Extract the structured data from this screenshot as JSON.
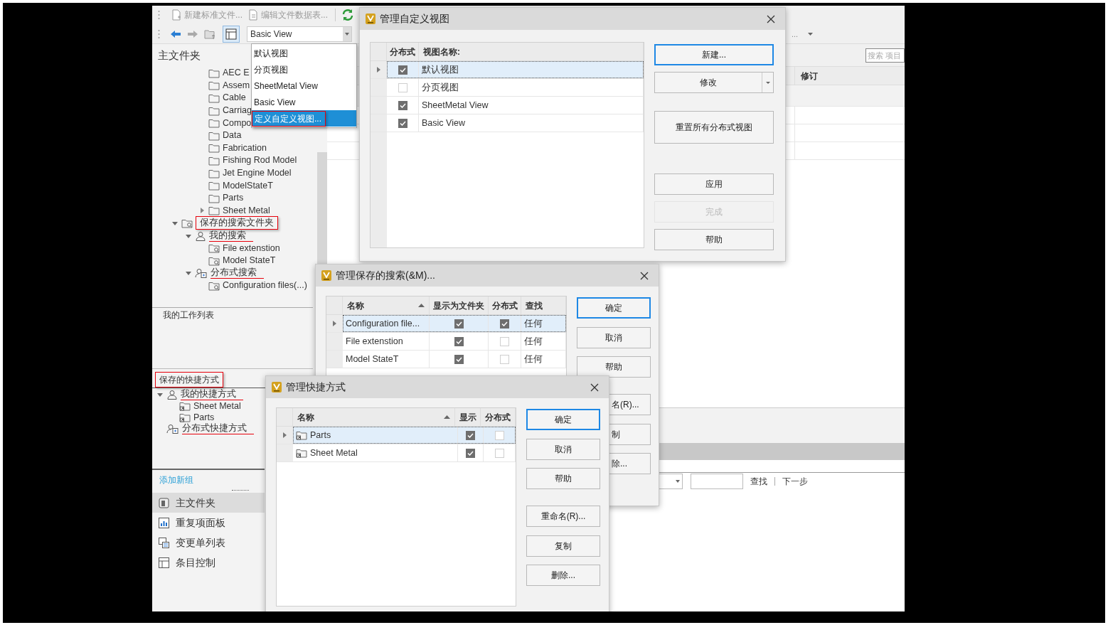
{
  "toolbar": {
    "actions": [
      {
        "label": "新建标准文件...",
        "kind": "new"
      },
      {
        "label": "编辑文件数据表...",
        "kind": "edit"
      }
    ],
    "view_select": {
      "value": "Basic View"
    },
    "overflow": "..."
  },
  "view_menu": [
    {
      "label": "默认视图",
      "selected": false
    },
    {
      "label": "分页视图",
      "selected": false
    },
    {
      "label": "SheetMetal View",
      "selected": false
    },
    {
      "label": "Basic View",
      "selected": false
    },
    {
      "label": "定义自定义视图...",
      "selected": true,
      "boxed": true
    }
  ],
  "left_panel": {
    "title": "主文件夹",
    "folders": [
      {
        "label": "AEC E"
      },
      {
        "label": "Assem"
      },
      {
        "label": "Cable"
      },
      {
        "label": "Carriag"
      },
      {
        "label": "Compo"
      },
      {
        "label": "Data"
      },
      {
        "label": "Fabrication"
      },
      {
        "label": "Fishing Rod Model"
      },
      {
        "label": "Jet Engine Model"
      },
      {
        "label": "ModelStateT"
      },
      {
        "label": "Parts"
      },
      {
        "label": "Sheet Metal",
        "expanded": false
      }
    ],
    "search_tree": [
      {
        "label": "保存的搜索文件夹",
        "kind": "search-folder",
        "expanded": true,
        "boxed": true,
        "children": [
          {
            "label": "我的搜索",
            "kind": "user",
            "expanded": true,
            "underlined": true,
            "children": [
              {
                "label": "File extenstion",
                "kind": "saved-search"
              },
              {
                "label": "Model StateT",
                "kind": "saved-search"
              }
            ]
          },
          {
            "label": "分布式搜索",
            "kind": "distributed",
            "expanded": true,
            "underlined": true,
            "children": [
              {
                "label": "Configuration files(...)",
                "kind": "saved-search"
              }
            ]
          }
        ]
      }
    ],
    "worklist_title": "我的工作列表",
    "shortcuts_title": {
      "label": "保存的快捷方式",
      "boxed": true
    },
    "shortcut_tree": [
      {
        "label": "我的快捷方式",
        "kind": "user",
        "expanded": true,
        "underlined": true,
        "children": [
          {
            "label": "Sheet Metal",
            "kind": "shortcut"
          },
          {
            "label": "Parts",
            "kind": "shortcut"
          }
        ]
      },
      {
        "label": "分布式快捷方式",
        "kind": "distributed",
        "underlined": true
      }
    ],
    "add_group": "添加新组",
    "nav": [
      {
        "label": "主文件夹",
        "kind": "folder",
        "selected": true
      },
      {
        "label": "重复项面板",
        "kind": "chart",
        "selected": false
      },
      {
        "label": "变更单列表",
        "kind": "list",
        "selected": false
      },
      {
        "label": "条目控制",
        "kind": "grid",
        "selected": false
      }
    ]
  },
  "main": {
    "search": {
      "placeholder": "搜索 项目"
    },
    "revision_column": "修订",
    "find_bar": {
      "find": "查找",
      "next": "下一步"
    }
  },
  "dialogs": [
    {
      "kind": "views",
      "title": "管理自定义视图",
      "table": {
        "columns": [
          {
            "label": "分布式",
            "sorted": false
          },
          {
            "label": "视图名称:",
            "sorted": false
          }
        ],
        "rows": [
          {
            "selected": true,
            "cells": [
              {
                "kind": "check",
                "checked": true
              },
              {
                "kind": "text",
                "text": "默认视图"
              }
            ]
          },
          {
            "selected": false,
            "cells": [
              {
                "kind": "check",
                "checked": false
              },
              {
                "kind": "text",
                "text": "分页视图"
              }
            ]
          },
          {
            "selected": false,
            "cells": [
              {
                "kind": "check",
                "checked": true
              },
              {
                "kind": "text",
                "text": "SheetMetal View"
              }
            ]
          },
          {
            "selected": false,
            "cells": [
              {
                "kind": "check",
                "checked": true
              },
              {
                "kind": "text",
                "text": "Basic View"
              }
            ]
          }
        ]
      },
      "buttons": [
        {
          "label": "新建...",
          "kind": "primary",
          "disabled": false
        },
        {
          "label": "修改",
          "kind": "split",
          "disabled": false
        },
        {
          "label": "重置所有分布式视图",
          "kind": "tall",
          "disabled": false
        },
        {
          "label": "应用",
          "kind": "normal",
          "disabled": false
        },
        {
          "label": "完成",
          "kind": "normal",
          "disabled": true
        },
        {
          "label": "帮助",
          "kind": "normal",
          "disabled": false
        }
      ]
    },
    {
      "kind": "searches",
      "title": "管理保存的搜索(&M)...",
      "table": {
        "columns": [
          {
            "label": "名称",
            "sorted": true
          },
          {
            "label": "显示为文件夹",
            "sorted": false
          },
          {
            "label": "分布式",
            "sorted": false
          },
          {
            "label": "查找",
            "sorted": false
          }
        ],
        "rows": [
          {
            "selected": true,
            "cells": [
              {
                "kind": "text",
                "text": "Configuration file..."
              },
              {
                "kind": "check",
                "checked": true
              },
              {
                "kind": "check",
                "checked": true
              },
              {
                "kind": "text",
                "text": "任何"
              }
            ]
          },
          {
            "selected": false,
            "cells": [
              {
                "kind": "text",
                "text": "File extenstion"
              },
              {
                "kind": "check",
                "checked": true
              },
              {
                "kind": "check",
                "checked": false
              },
              {
                "kind": "text",
                "text": "任何"
              }
            ]
          },
          {
            "selected": false,
            "cells": [
              {
                "kind": "text",
                "text": "Model StateT"
              },
              {
                "kind": "check",
                "checked": true
              },
              {
                "kind": "check",
                "checked": false
              },
              {
                "kind": "text",
                "text": "任何"
              }
            ]
          }
        ]
      },
      "buttons": [
        {
          "label": "确定",
          "kind": "primary",
          "disabled": false
        },
        {
          "label": "取消",
          "kind": "normal",
          "disabled": false
        },
        {
          "label": "帮助",
          "kind": "normal",
          "disabled": false
        },
        {
          "label": "名(R)...",
          "kind": "partial",
          "disabled": false
        },
        {
          "label": "制",
          "kind": "partial",
          "disabled": false
        },
        {
          "label": "除...",
          "kind": "partial",
          "disabled": false
        }
      ]
    },
    {
      "kind": "shortcuts",
      "title": "管理快捷方式",
      "table": {
        "columns": [
          {
            "label": "名称",
            "sorted": true
          },
          {
            "label": "显示",
            "sorted": false
          },
          {
            "label": "分布式",
            "sorted": false
          }
        ],
        "rows": [
          {
            "selected": true,
            "cells": [
              {
                "kind": "shortcut",
                "text": "Parts"
              },
              {
                "kind": "check",
                "checked": true
              },
              {
                "kind": "check",
                "checked": false
              }
            ]
          },
          {
            "selected": false,
            "cells": [
              {
                "kind": "shortcut",
                "text": "Sheet Metal"
              },
              {
                "kind": "check",
                "checked": true
              },
              {
                "kind": "check",
                "checked": false
              }
            ]
          }
        ]
      },
      "buttons": [
        {
          "label": "确定",
          "kind": "primary",
          "disabled": false
        },
        {
          "label": "取消",
          "kind": "normal",
          "disabled": false
        },
        {
          "label": "帮助",
          "kind": "normal",
          "disabled": false
        },
        {
          "label": "重命名(R)...",
          "kind": "normal",
          "disabled": false
        },
        {
          "label": "复制",
          "kind": "normal",
          "disabled": false
        },
        {
          "label": "删除...",
          "kind": "normal",
          "disabled": false
        }
      ]
    }
  ]
}
